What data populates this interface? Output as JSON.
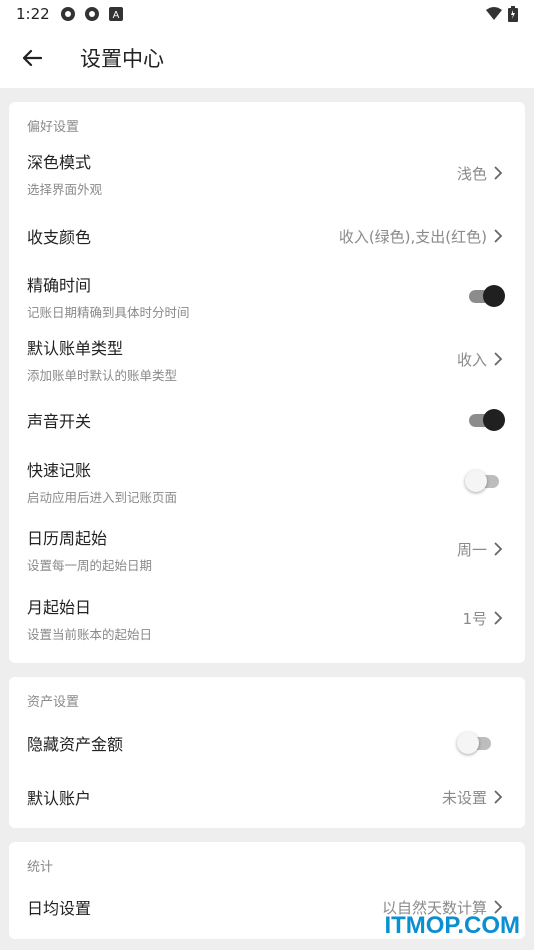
{
  "status": {
    "time": "1:22"
  },
  "header": {
    "title": "设置中心"
  },
  "sections": {
    "prefs": {
      "label": "偏好设置",
      "dark_mode": {
        "title": "深色模式",
        "subtitle": "选择界面外观",
        "value": "浅色"
      },
      "colors": {
        "title": "收支颜色",
        "value": "收入(绿色),支出(红色)"
      },
      "precise_time": {
        "title": "精确时间",
        "subtitle": "记账日期精确到具体时分时间",
        "on": true
      },
      "default_type": {
        "title": "默认账单类型",
        "subtitle": "添加账单时默认的账单类型",
        "value": "收入"
      },
      "sound": {
        "title": "声音开关",
        "on": true
      },
      "quick": {
        "title": "快速记账",
        "subtitle": "启动应用后进入到记账页面",
        "on": false
      },
      "week_start": {
        "title": "日历周起始",
        "subtitle": "设置每一周的起始日期",
        "value": "周一"
      },
      "month_start": {
        "title": "月起始日",
        "subtitle": "设置当前账本的起始日",
        "value": "1号"
      }
    },
    "assets": {
      "label": "资产设置",
      "hide_amount": {
        "title": "隐藏资产金额",
        "on": false
      },
      "default_account": {
        "title": "默认账户",
        "value": "未设置"
      }
    },
    "stats": {
      "label": "统计",
      "daily_avg": {
        "title": "日均设置",
        "value": "以自然天数计算"
      }
    }
  },
  "watermark": "ITMOP.COM",
  "colors": {
    "toggle_on": "#202020",
    "accent_watermark": "#0a8fd0"
  }
}
